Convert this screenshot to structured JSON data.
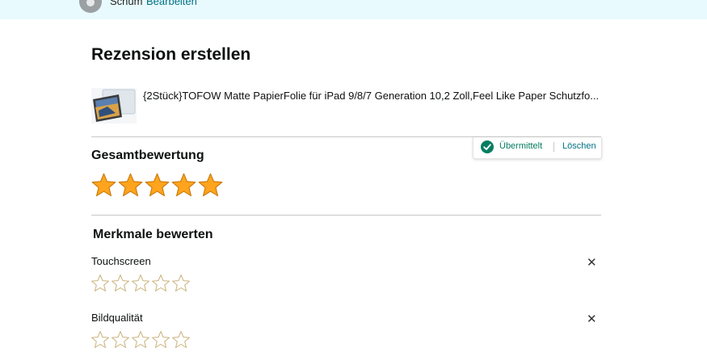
{
  "header": {
    "user_name": "Schum",
    "edit_label": "Bearbeiten"
  },
  "page": {
    "title": "Rezension erstellen"
  },
  "product": {
    "title": "{2Stück}TOFOW Matte PapierFolie für iPad 9/8/7 Generation 10,2 Zoll,Feel Like Paper Schutzfo..."
  },
  "overall": {
    "heading": "Gesamtbewertung",
    "rating": 5,
    "max": 5,
    "status_label": "Übermittelt",
    "delete_label": "Löschen",
    "status_color": "#067d62",
    "star_color": "#ffa41c"
  },
  "features": {
    "heading": "Merkmale bewerten",
    "items": [
      {
        "label": "Touchscreen",
        "rating": 0,
        "max": 5
      },
      {
        "label": "Bildqualität",
        "rating": 0,
        "max": 5
      }
    ]
  },
  "icons": {
    "close": "close-icon",
    "check": "check-circle-icon",
    "avatar": "user-avatar-icon"
  }
}
